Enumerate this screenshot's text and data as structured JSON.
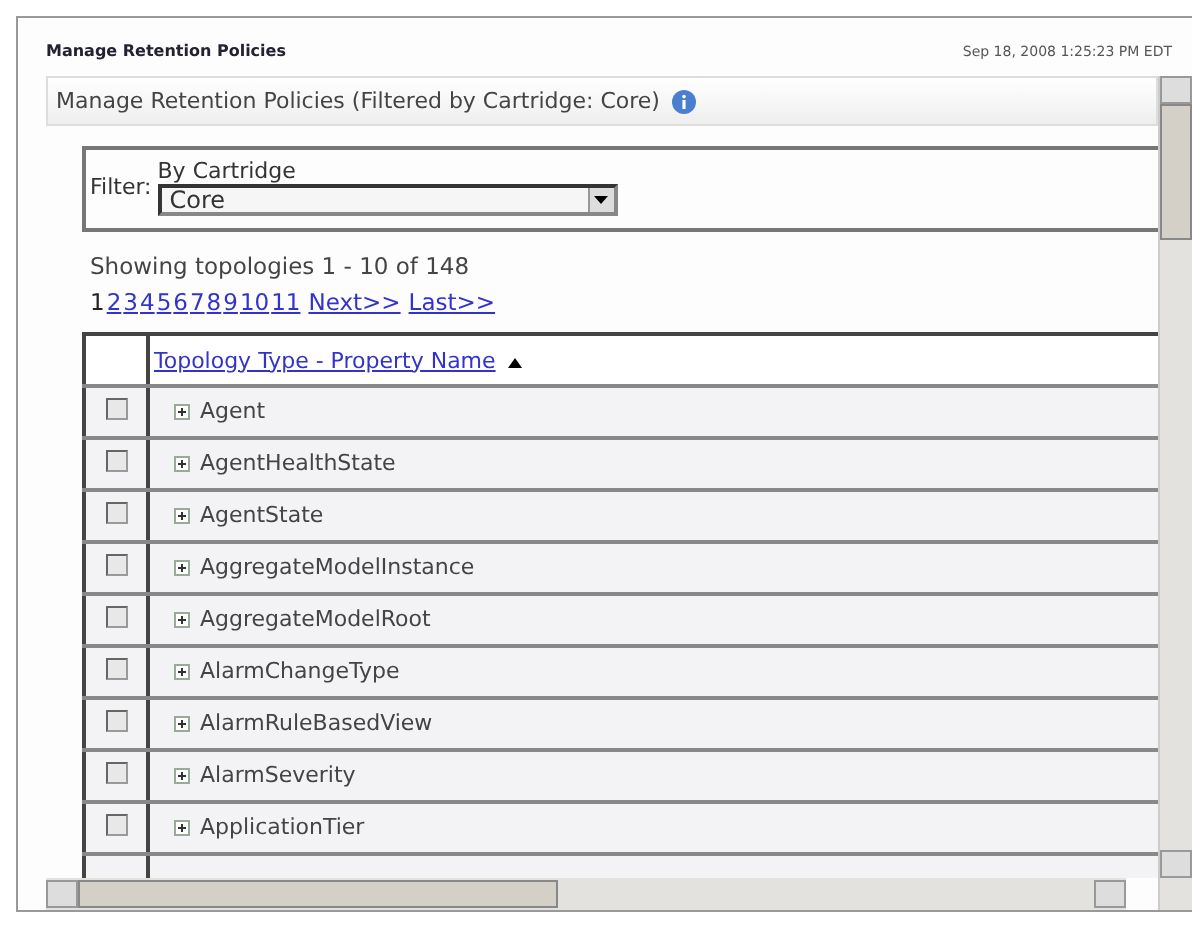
{
  "header": {
    "title": "Manage Retention Policies",
    "timestamp": "Sep 18, 2008 1:25:23 PM EDT"
  },
  "panel": {
    "title": "Manage Retention Policies (Filtered by Cartridge: Core)"
  },
  "filter": {
    "label": "Filter:",
    "caption": "By Cartridge",
    "value": "Core"
  },
  "summary": "Showing topologies 1 - 10 of 148",
  "pages": [
    {
      "label": "1",
      "selected": true
    },
    {
      "label": "2",
      "selected": false
    },
    {
      "label": "3",
      "selected": false
    },
    {
      "label": "4",
      "selected": false
    },
    {
      "label": "5",
      "selected": false
    },
    {
      "label": "6",
      "selected": false
    },
    {
      "label": "7",
      "selected": false
    },
    {
      "label": "8",
      "selected": false
    },
    {
      "label": "9",
      "selected": false
    },
    {
      "label": "10",
      "selected": false
    },
    {
      "label": "11",
      "selected": false
    },
    {
      "label": "Next>>",
      "selected": false
    },
    {
      "label": "Last>>",
      "selected": false
    }
  ],
  "table": {
    "column": "Topology Type - Property Name",
    "rows": [
      {
        "name": "Agent",
        "checked": false
      },
      {
        "name": "AgentHealthState",
        "checked": false
      },
      {
        "name": "AgentState",
        "checked": false
      },
      {
        "name": "AggregateModelInstance",
        "checked": false
      },
      {
        "name": "AggregateModelRoot",
        "checked": false
      },
      {
        "name": "AlarmChangeType",
        "checked": false
      },
      {
        "name": "AlarmRuleBasedView",
        "checked": false
      },
      {
        "name": "AlarmSeverity",
        "checked": false
      },
      {
        "name": "ApplicationTier",
        "checked": false
      }
    ]
  }
}
